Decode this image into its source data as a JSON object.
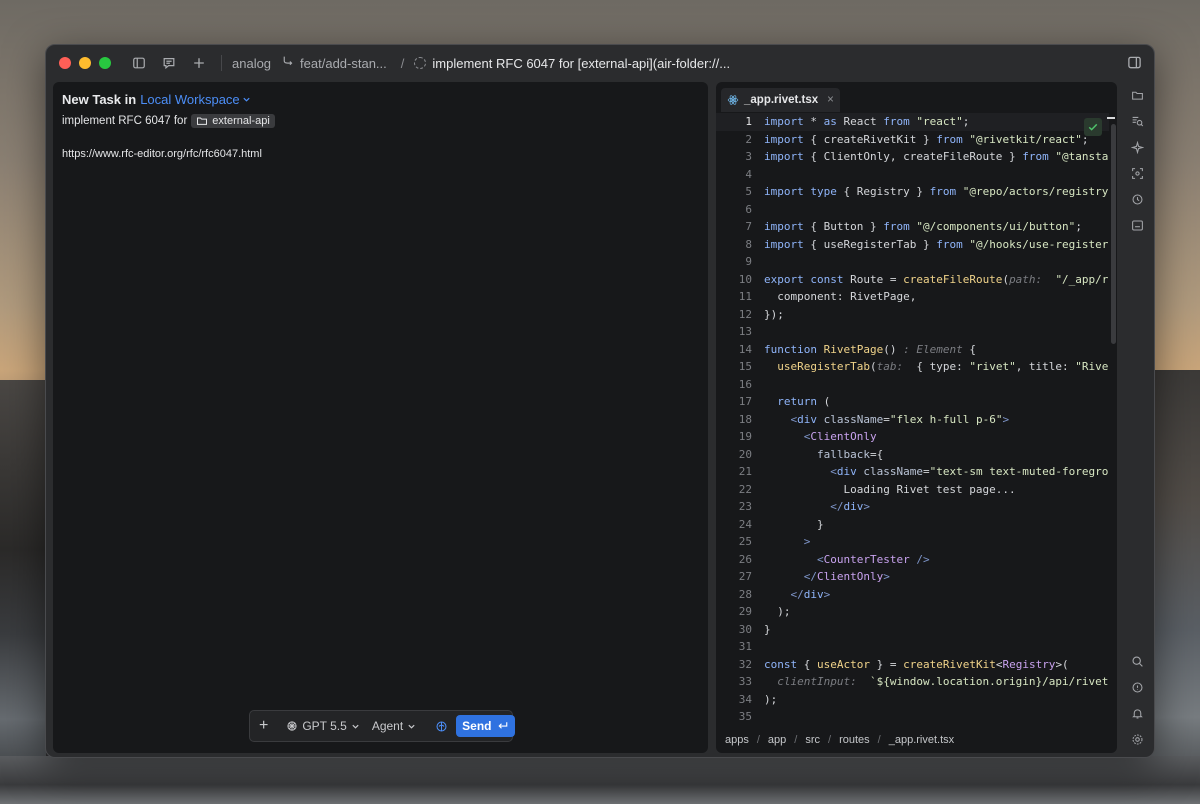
{
  "titlebar": {
    "project": "analog",
    "branch": "feat/add-stan...",
    "slash": "/",
    "task_title": "implement RFC 6047 for [external-api](air-folder://..."
  },
  "task_panel": {
    "heading_prefix": "New Task in",
    "workspace": "Local Workspace",
    "task_prefix": "implement RFC 6047 for",
    "folder_chip": "external-api",
    "url": "https://www.rfc-editor.org/rfc/rfc6047.html"
  },
  "composer": {
    "plus": "+",
    "model": "GPT 5.5",
    "mode": "Agent",
    "send_label": "Send"
  },
  "editor": {
    "tab_label": "_app.rivet.tsx",
    "tab_close": "×",
    "active_line": 1,
    "breadcrumb": [
      "apps",
      "app",
      "src",
      "routes",
      "_app.rivet.tsx"
    ],
    "lines": [
      {
        "n": "1",
        "html": "<span class=\"kw\">import</span> * <span class=\"kw\">as</span> React <span class=\"kw\">from</span> <span class=\"str\">\"react\"</span>;"
      },
      {
        "n": "2",
        "html": "<span class=\"kw\">import</span> { createRivetKit } <span class=\"kw\">from</span> <span class=\"str\">\"@rivetkit/react\"</span>;"
      },
      {
        "n": "3",
        "html": "<span class=\"kw\">import</span> { ClientOnly, createFileRoute } <span class=\"kw\">from</span> <span class=\"str\">\"@tanstack/re</span>"
      },
      {
        "n": "4",
        "html": ""
      },
      {
        "n": "5",
        "html": "<span class=\"kw\">import type</span> { Registry } <span class=\"kw\">from</span> <span class=\"str\">\"@repo/actors/registry\"</span>;"
      },
      {
        "n": "6",
        "html": ""
      },
      {
        "n": "7",
        "html": "<span class=\"kw\">import</span> { Button } <span class=\"kw\">from</span> <span class=\"str\">\"@/components/ui/button\"</span>;"
      },
      {
        "n": "8",
        "html": "<span class=\"kw\">import</span> { useRegisterTab } <span class=\"kw\">from</span> <span class=\"str\">\"@/hooks/use-register-tab\"</span>"
      },
      {
        "n": "9",
        "html": ""
      },
      {
        "n": "10",
        "html": "<span class=\"kw\">export const</span> Route = <span class=\"fn\">createFileRoute</span>(<span class=\"hint\">path: </span> <span class=\"str\">\"/_app/rivet\"</span>"
      },
      {
        "n": "11",
        "html": "  component: RivetPage,"
      },
      {
        "n": "12",
        "html": "});"
      },
      {
        "n": "13",
        "html": ""
      },
      {
        "n": "14",
        "html": "<span class=\"kw\">function</span> <span class=\"fn\">RivetPage</span>() <span class=\"hint\">: Element</span> {"
      },
      {
        "n": "15",
        "html": "  <span class=\"fn\">useRegisterTab</span>(<span class=\"hint\">tab: </span> { type: <span class=\"str\">\"rivet\"</span>, title: <span class=\"str\">\"Rivet\"</span>, u"
      },
      {
        "n": "16",
        "html": ""
      },
      {
        "n": "17",
        "html": "  <span class=\"kw\">return</span> ("
      },
      {
        "n": "18",
        "html": "    <span class=\"brk\">&lt;</span><span class=\"kw\">div</span> <span class=\"attr\">className</span>=<span class=\"str\">\"flex h-full p-6\"</span><span class=\"brk\">&gt;</span>"
      },
      {
        "n": "19",
        "html": "      <span class=\"brk\">&lt;</span><span class=\"tag\">ClientOnly</span>"
      },
      {
        "n": "20",
        "html": "        <span class=\"attr\">fallback</span>={"
      },
      {
        "n": "21",
        "html": "          <span class=\"brk\">&lt;</span><span class=\"kw\">div</span> <span class=\"attr\">className</span>=<span class=\"str\">\"text-sm text-muted-foreground\"</span><span class=\"brk\">&gt;</span>"
      },
      {
        "n": "22",
        "html": "            Loading Rivet test page..."
      },
      {
        "n": "23",
        "html": "          <span class=\"brk\">&lt;/</span><span class=\"kw\">div</span><span class=\"brk\">&gt;</span>"
      },
      {
        "n": "24",
        "html": "        }"
      },
      {
        "n": "25",
        "html": "      <span class=\"brk\">&gt;</span>"
      },
      {
        "n": "26",
        "html": "        <span class=\"brk\">&lt;</span><span class=\"tag\">CounterTester</span> <span class=\"brk\">/&gt;</span>"
      },
      {
        "n": "27",
        "html": "      <span class=\"brk\">&lt;/</span><span class=\"tag\">ClientOnly</span><span class=\"brk\">&gt;</span>"
      },
      {
        "n": "28",
        "html": "    <span class=\"brk\">&lt;/</span><span class=\"kw\">div</span><span class=\"brk\">&gt;</span>"
      },
      {
        "n": "29",
        "html": "  );"
      },
      {
        "n": "30",
        "html": "}"
      },
      {
        "n": "31",
        "html": ""
      },
      {
        "n": "32",
        "html": "<span class=\"kw\">const</span> { <span class=\"fn\">useActor</span> } = <span class=\"fn\">createRivetKit</span>&lt;<span class=\"tag\">Registry</span>&gt;("
      },
      {
        "n": "33",
        "html": "  <span class=\"hint\">clientInput: </span> <span class=\"str\">`${window.location.origin}/api/rivet`</span>,"
      },
      {
        "n": "34",
        "html": ");"
      },
      {
        "n": "35",
        "html": ""
      }
    ]
  },
  "icons": {
    "sidebar_toggle": "sidebar-icon",
    "chat": "chat-icon",
    "new": "plus-icon",
    "branch": "branch-icon",
    "right_panel": "panel-right-icon",
    "rail_top": [
      "folder-icon",
      "search-file-icon",
      "sparkle-icon",
      "screenshot-icon",
      "history-icon",
      "terminal-icon"
    ],
    "rail_bottom": [
      "search-icon",
      "comment-icon",
      "bell-icon",
      "settings-icon"
    ]
  },
  "colors": {
    "accent": "#4c8ef7",
    "send_button": "#2f72e0",
    "success": "#4fc26b"
  }
}
